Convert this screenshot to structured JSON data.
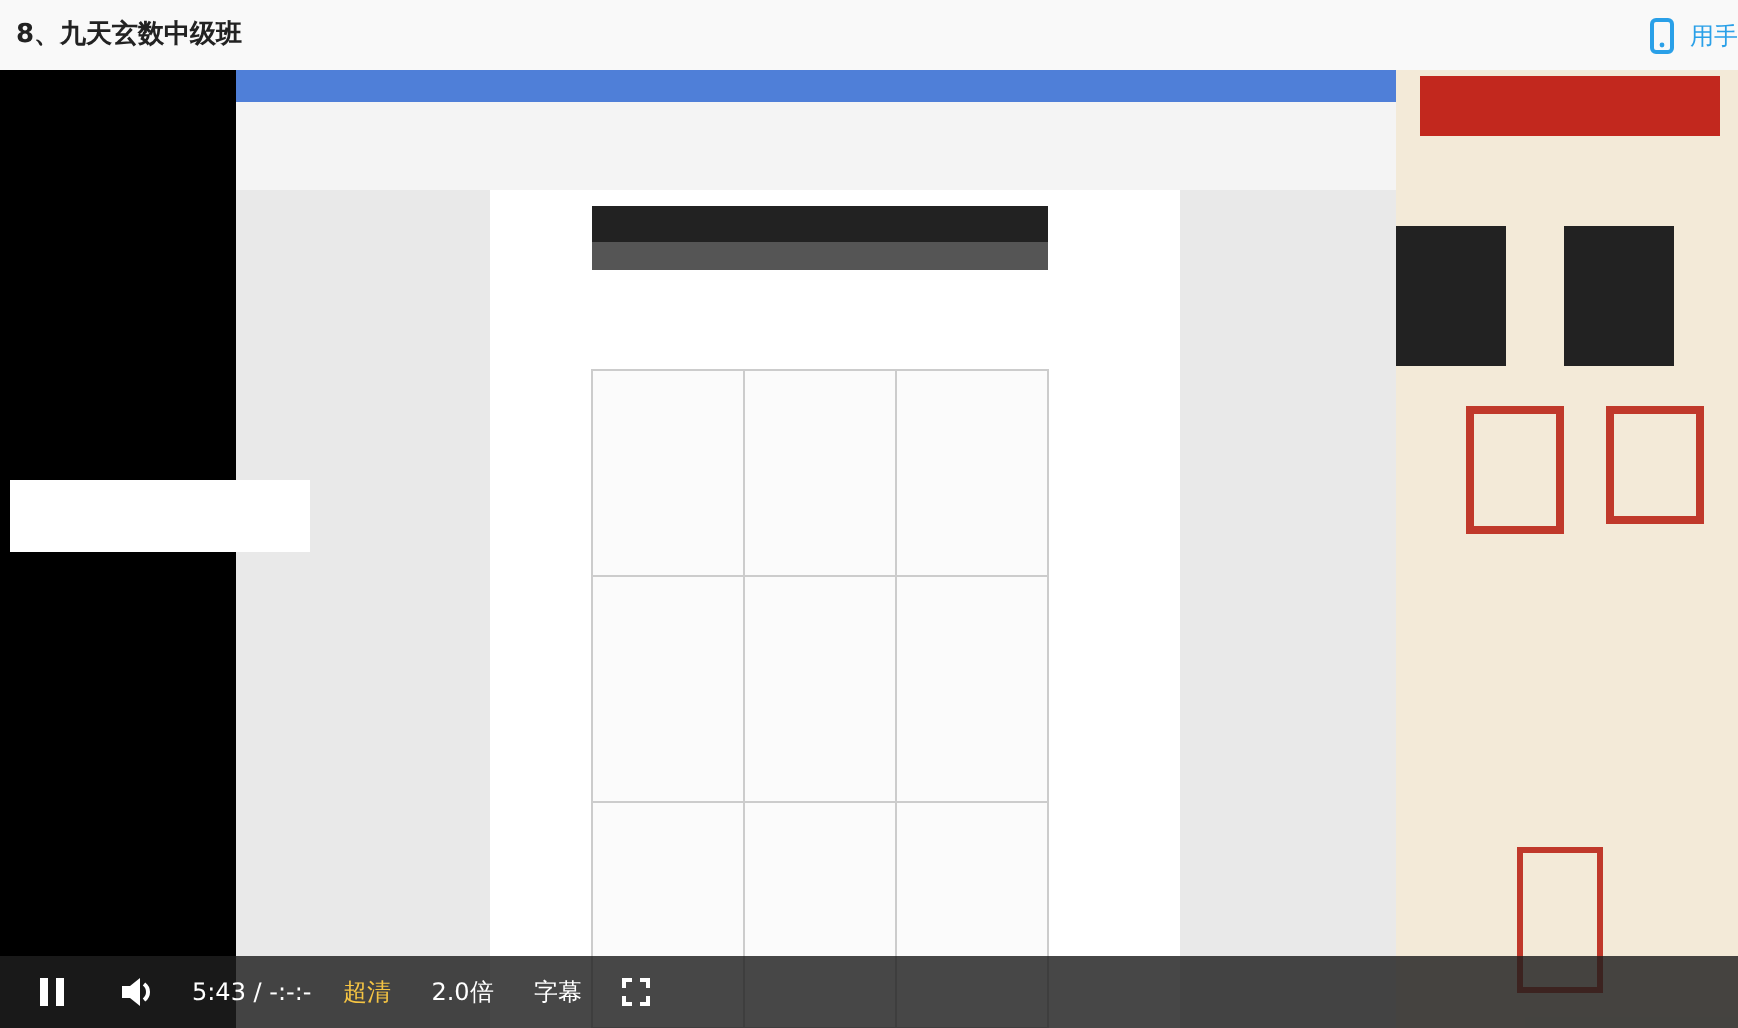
{
  "title": "8、九天玄数中级班",
  "mobile_link": "用手",
  "player": {
    "playing": true,
    "time": "5:43 / -:-:-",
    "options": [
      {
        "label": "超清",
        "selected": true
      },
      {
        "label": "2.0倍",
        "selected": false
      },
      {
        "label": "字幕",
        "selected": false
      }
    ]
  }
}
